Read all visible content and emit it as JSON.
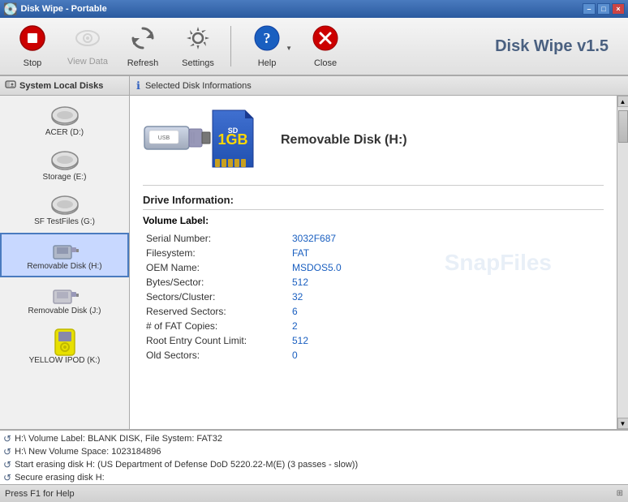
{
  "window": {
    "title": "Disk Wipe - Portable",
    "controls": [
      "–",
      "□",
      "×"
    ]
  },
  "toolbar": {
    "app_title": "Disk Wipe v1.5",
    "buttons": [
      {
        "id": "stop",
        "label": "Stop",
        "icon": "⏹",
        "disabled": false
      },
      {
        "id": "view-data",
        "label": "View Data",
        "icon": "🔍",
        "disabled": true
      },
      {
        "id": "refresh",
        "label": "Refresh",
        "icon": "🔄",
        "disabled": false
      },
      {
        "id": "settings",
        "label": "Settings",
        "icon": "⚙",
        "disabled": false
      },
      {
        "id": "help",
        "label": "Help",
        "icon": "❓",
        "disabled": false,
        "has_arrow": true
      },
      {
        "id": "close",
        "label": "Close",
        "icon": "✕",
        "disabled": false
      }
    ]
  },
  "sidebar": {
    "header": "System Local Disks",
    "disks": [
      {
        "id": "acer-d",
        "label": "ACER (D:)",
        "icon": "💾",
        "selected": false
      },
      {
        "id": "storage-e",
        "label": "Storage (E:)",
        "icon": "💾",
        "selected": false
      },
      {
        "id": "sf-testfiles-g",
        "label": "SF TestFiles (G:)",
        "icon": "💾",
        "selected": false
      },
      {
        "id": "removable-h",
        "label": "Removable Disk (H:)",
        "icon": "💾",
        "selected": true
      },
      {
        "id": "removable-j",
        "label": "Removable Disk (J:)",
        "icon": "💾",
        "selected": false
      },
      {
        "id": "yellow-ipod-k",
        "label": "YELLOW IPOD (K:)",
        "icon": "💾",
        "selected": false
      }
    ]
  },
  "content": {
    "header": "Selected Disk Informations",
    "disk_name": "Removable Disk  (H:)",
    "volume_label_section": "Drive Information:",
    "volume_label_header": "Volume Label:",
    "fields": [
      {
        "label": "Serial Number:",
        "value": "3032F687"
      },
      {
        "label": "Filesystem:",
        "value": "FAT"
      },
      {
        "label": "OEM Name:",
        "value": "MSDOS5.0"
      },
      {
        "label": "Bytes/Sector:",
        "value": "512"
      },
      {
        "label": "Sectors/Cluster:",
        "value": "32"
      },
      {
        "label": "Reserved Sectors:",
        "value": "6"
      },
      {
        "label": "# of FAT Copies:",
        "value": "2"
      },
      {
        "label": "Root Entry Count Limit:",
        "value": "512"
      },
      {
        "label": "Old Sectors:",
        "value": "0"
      }
    ],
    "watermark": "SnapFiles"
  },
  "log": {
    "lines": [
      "H:\\ Volume Label: BLANK DISK, File System: FAT32",
      "H:\\ New Volume Space: 1023184896",
      "Start erasing disk H: (US Department of Defense DoD 5220.22-M(E) (3 passes - slow))",
      "Secure erasing disk H:"
    ]
  },
  "statusbar": {
    "text": "Press F1 for Help"
  }
}
